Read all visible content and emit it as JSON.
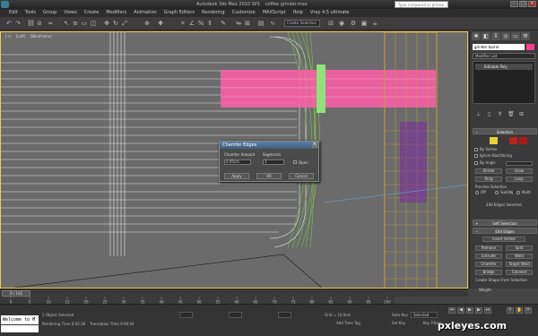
{
  "window": {
    "app_title": "Autodesk 3ds Max  2010 SP1",
    "file_name": "coffee grinder.max",
    "search_placeholder": "Type a keyword or phrase"
  },
  "menu": [
    "Edit",
    "Tools",
    "Group",
    "Views",
    "Create",
    "Modifiers",
    "Animation",
    "Graph Editors",
    "Rendering",
    "Customize",
    "MAXScript",
    "Help",
    "Vray 4.5 ultimate"
  ],
  "toolbar": {
    "selection_filter": "Create Selection"
  },
  "viewport": {
    "labels": [
      "[+]",
      "[Left]",
      "[Wireframe]"
    ]
  },
  "command_panel": {
    "object_name": "grinder barrel",
    "modifier_list": "Modifier List",
    "stack_item": "Editable Poly",
    "selection": {
      "title": "Selection",
      "by_vertex": "By Vertex",
      "ignore_backfacing": "Ignore Backfacing",
      "by_angle": "By Angle",
      "shrink": "Shrink",
      "grow": "Grow",
      "ring": "Ring",
      "loop": "Loop",
      "preview_selection": "Preview Selection",
      "off": "Off",
      "subobj": "SubObj",
      "multi": "Multi",
      "status": "240 Edges Selected"
    },
    "soft_selection": "Soft Selection",
    "edit_edges": {
      "title": "Edit Edges",
      "insert_vertex": "Insert Vertex",
      "remove": "Remove",
      "split": "Split",
      "extrude": "Extrude",
      "weld": "Weld",
      "chamfer": "Chamfer",
      "target_weld": "Target Weld",
      "bridge": "Bridge",
      "connect": "Connect",
      "create_shape": "Create Shape From Selection",
      "weight_label": "Weight",
      "weight_value": "0.0",
      "crease_label": "Crease",
      "crease_value": "0.0"
    }
  },
  "dialog": {
    "title": "Chamfer Edges",
    "amount_label": "Chamfer Amount",
    "amount_value": "0.05cm",
    "segments_label": "Segments",
    "segments_value": "1",
    "open_label": "Open",
    "apply": "Apply",
    "ok": "OK",
    "cancel": "Cancel"
  },
  "timeline": {
    "slider": "0 / 100",
    "ticks": [
      "0",
      "5",
      "10",
      "15",
      "20",
      "25",
      "30",
      "35",
      "40",
      "45",
      "50",
      "55",
      "60",
      "65",
      "70",
      "75",
      "80",
      "85",
      "90",
      "95",
      "100"
    ]
  },
  "status": {
    "maxscript": "Welcome to M",
    "objects_selected": "1 Object Selected",
    "rendering_time": "Rendering Time  0:02:38",
    "translation_time": "Translation Time  0:00:04",
    "grid": "Grid = 10.0cm",
    "auto_key": "Auto Key",
    "set_key": "Set Key",
    "selected": "Selected",
    "key_filters": "Key Filters...",
    "add_time_tag": "Add Time Tag"
  },
  "watermark": "pxleyes.com",
  "colors": {
    "object_color": "#ff3f8c",
    "wire_pink": "#ff5fa8",
    "wire_green": "#7fd23a",
    "wire_orange": "#c8a030"
  }
}
